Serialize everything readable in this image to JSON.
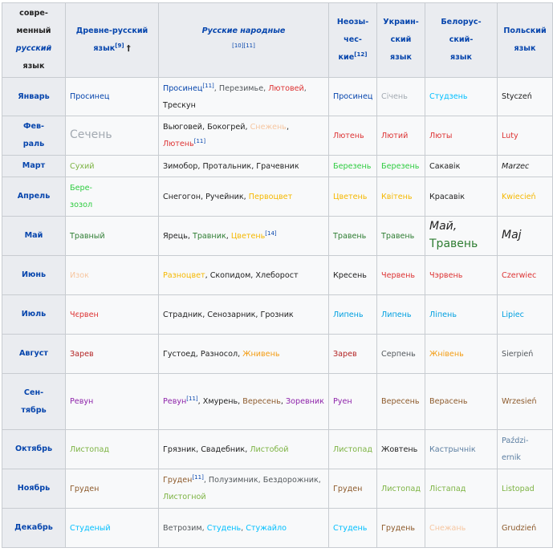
{
  "headers": [
    {
      "lines": [
        "совре-",
        "менный",
        "русский",
        "язык"
      ],
      "italic_line": 2
    },
    {
      "lines": [
        "Древне-русский",
        "язык"
      ],
      "sup": "[9]",
      "dagger": "†"
    },
    {
      "lines": [
        "Русские народные"
      ],
      "sup_line": "[10][11]",
      "italic": true
    },
    {
      "lines": [
        "Неозы-",
        "чес-",
        "кие"
      ],
      "sup": "[12]"
    },
    {
      "lines": [
        "Украин-",
        "ский",
        "язык"
      ]
    },
    {
      "lines": [
        "Белорус-",
        "ский-",
        "язык"
      ]
    },
    {
      "lines": [
        "Польский",
        "язык"
      ]
    }
  ],
  "rows": [
    {
      "month": [
        "Январь"
      ],
      "old": [
        {
          "t": "Просинец",
          "c": "#0645ad"
        }
      ],
      "folk": [
        {
          "t": "Просинец",
          "c": "#0645ad",
          "sup": "[11]"
        },
        {
          "t": ", Перезимье, ",
          "c": "#54595d"
        },
        {
          "t": "Лютовей",
          "c": "#d33"
        },
        {
          "t": ",",
          "c": "#54595d"
        },
        {
          "br": true
        },
        {
          "t": "Трескун",
          "c": "#222"
        }
      ],
      "neo": [
        {
          "t": "Просинец",
          "c": "#0645ad"
        }
      ],
      "ukr": [
        {
          "t": "Січень",
          "c": "#a2a9b1"
        }
      ],
      "bel": [
        {
          "t": "Студзень",
          "c": "#00bfff"
        }
      ],
      "pol": [
        {
          "t": "Styczeń",
          "c": "#222"
        }
      ]
    },
    {
      "month": [
        "Фев-",
        "раль"
      ],
      "old": [
        {
          "t": "Сечень",
          "c": "#a2a9b1",
          "big": true
        }
      ],
      "folk": [
        {
          "t": "Вьюговей, Бокогрей, ",
          "c": "#222"
        },
        {
          "t": "Снежень",
          "c": "#f6c6a0"
        },
        {
          "t": ",",
          "c": "#222"
        },
        {
          "br": true
        },
        {
          "t": "Лютень",
          "c": "#d33",
          "sup": "[11]"
        }
      ],
      "neo": [
        {
          "t": "Лютень",
          "c": "#d33"
        }
      ],
      "ukr": [
        {
          "t": "Лютий",
          "c": "#d33"
        }
      ],
      "bel": [
        {
          "t": "Люты",
          "c": "#d33"
        }
      ],
      "pol": [
        {
          "t": "Luty",
          "c": "#d33"
        }
      ]
    },
    {
      "month": [
        "Март"
      ],
      "old": [
        {
          "t": "Сухий",
          "c": "#7cb342"
        }
      ],
      "folk": [
        {
          "t": "Зимобор, Протальник, Грачевник",
          "c": "#222"
        }
      ],
      "neo": [
        {
          "t": "Березень",
          "c": "#2ecc40"
        }
      ],
      "ukr": [
        {
          "t": "Березень",
          "c": "#2ecc40"
        }
      ],
      "bel": [
        {
          "t": "Сакавік",
          "c": "#222"
        }
      ],
      "pol": [
        {
          "t": "Marzec",
          "c": "#222",
          "italic": true
        }
      ]
    },
    {
      "month": [
        "Апрель"
      ],
      "old": [
        {
          "t": "Бере-",
          "c": "#2ecc40"
        },
        {
          "br": true
        },
        {
          "t": "зозол",
          "c": "#2ecc40"
        }
      ],
      "folk": [
        {
          "t": "Снегогон, Ручейник, ",
          "c": "#222"
        },
        {
          "t": "Первоцвет",
          "c": "#f5b800"
        }
      ],
      "neo": [
        {
          "t": "Цветень",
          "c": "#f5b800"
        }
      ],
      "ukr": [
        {
          "t": "Квітень",
          "c": "#f5b800"
        }
      ],
      "bel": [
        {
          "t": "Красавік",
          "c": "#222"
        }
      ],
      "pol": [
        {
          "t": "Kwiecień",
          "c": "#f5b800"
        }
      ]
    },
    {
      "month": [
        "Май"
      ],
      "old": [
        {
          "t": "Травный",
          "c": "#2e7d32"
        }
      ],
      "folk": [
        {
          "t": "Ярець, ",
          "c": "#222"
        },
        {
          "t": "Травник",
          "c": "#2e7d32"
        },
        {
          "t": ", ",
          "c": "#222"
        },
        {
          "t": "Цветень",
          "c": "#f5b800",
          "sup": "[14]"
        }
      ],
      "neo": [
        {
          "t": "Травень",
          "c": "#2e7d32"
        }
      ],
      "ukr": [
        {
          "t": "Травень",
          "c": "#2e7d32"
        }
      ],
      "bel": [
        {
          "t": "Май,",
          "c": "#222",
          "big": true,
          "italic": true
        },
        {
          "br": true
        },
        {
          "t": "Травень",
          "c": "#2e7d32",
          "big": true
        }
      ],
      "pol": [
        {
          "t": "Maj",
          "c": "#222",
          "big": true,
          "italic": true
        }
      ]
    },
    {
      "month": [
        "Июнь"
      ],
      "old": [
        {
          "t": "Изок",
          "c": "#f6c6a0"
        }
      ],
      "folk": [
        {
          "t": "Разноцвет",
          "c": "#f5b800"
        },
        {
          "t": ", Скопидом, Хлеборост",
          "c": "#222"
        }
      ],
      "neo": [
        {
          "t": "Кресень",
          "c": "#222"
        }
      ],
      "ukr": [
        {
          "t": "Червень",
          "c": "#d33"
        }
      ],
      "bel": [
        {
          "t": "Чэрвень",
          "c": "#d33"
        }
      ],
      "pol": [
        {
          "t": "Czerwiec",
          "c": "#d33"
        }
      ]
    },
    {
      "month": [
        "Июль"
      ],
      "old": [
        {
          "t": "Чєрвен",
          "c": "#d33"
        }
      ],
      "folk": [
        {
          "t": "Страдник, Сенозарник, Грозник",
          "c": "#222"
        }
      ],
      "neo": [
        {
          "t": "Липень",
          "c": "#00a0e0"
        }
      ],
      "ukr": [
        {
          "t": "Липень",
          "c": "#00a0e0"
        }
      ],
      "bel": [
        {
          "t": "Ліпень",
          "c": "#00a0e0"
        }
      ],
      "pol": [
        {
          "t": "Lipiec",
          "c": "#00a0e0"
        }
      ]
    },
    {
      "month": [
        "Август"
      ],
      "old": [
        {
          "t": "Зарев",
          "c": "#b32424"
        }
      ],
      "folk": [
        {
          "t": "Густоед, Разносол, ",
          "c": "#222"
        },
        {
          "t": "Жнивень",
          "c": "#f39c12"
        }
      ],
      "neo": [
        {
          "t": "Зарев",
          "c": "#b32424"
        }
      ],
      "ukr": [
        {
          "t": "Серпень",
          "c": "#54595d"
        }
      ],
      "bel": [
        {
          "t": "Жнівень",
          "c": "#f39c12"
        }
      ],
      "pol": [
        {
          "t": "Sierpień",
          "c": "#54595d"
        }
      ]
    },
    {
      "month": [
        "Сен-",
        "тябрь"
      ],
      "old": [
        {
          "t": "Ревун",
          "c": "#8e24aa"
        }
      ],
      "folk": [
        {
          "t": "Ревун",
          "c": "#8e24aa",
          "sup": "[11]"
        },
        {
          "t": ", Хмурень, ",
          "c": "#222"
        },
        {
          "t": "Вересень",
          "c": "#8d5a2b"
        },
        {
          "t": ", ",
          "c": "#222"
        },
        {
          "t": "Зоревник",
          "c": "#8e24aa"
        }
      ],
      "neo": [
        {
          "t": "Руен",
          "c": "#8e24aa"
        }
      ],
      "ukr": [
        {
          "t": "Вересень",
          "c": "#8d5a2b"
        }
      ],
      "bel": [
        {
          "t": "Верасень",
          "c": "#8d5a2b"
        }
      ],
      "pol": [
        {
          "t": "Wrzesień",
          "c": "#8d5a2b"
        }
      ]
    },
    {
      "month": [
        "Октябрь"
      ],
      "old": [
        {
          "t": "Листопад",
          "c": "#7cb342"
        }
      ],
      "folk": [
        {
          "t": "Грязник, Свадебник, ",
          "c": "#222"
        },
        {
          "t": "Листобой",
          "c": "#7cb342"
        }
      ],
      "neo": [
        {
          "t": "Листопад",
          "c": "#7cb342"
        }
      ],
      "ukr": [
        {
          "t": "Жовтень",
          "c": "#222"
        }
      ],
      "bel": [
        {
          "t": "Кастрычнік",
          "c": "#5b7ea1"
        }
      ],
      "pol": [
        {
          "t": "Paździ-",
          "c": "#5b7ea1"
        },
        {
          "br": true
        },
        {
          "t": "ernik",
          "c": "#5b7ea1"
        }
      ]
    },
    {
      "month": [
        "Ноябрь"
      ],
      "old": [
        {
          "t": "Груден",
          "c": "#8d5a2b"
        }
      ],
      "folk": [
        {
          "t": "Груден",
          "c": "#8d5a2b",
          "sup": "[11]"
        },
        {
          "t": ", Полузимник, Бездорожник,",
          "c": "#54595d"
        },
        {
          "br": true
        },
        {
          "t": "Листогной",
          "c": "#7cb342"
        }
      ],
      "neo": [
        {
          "t": "Груден",
          "c": "#8d5a2b"
        }
      ],
      "ukr": [
        {
          "t": "Листопад",
          "c": "#7cb342"
        }
      ],
      "bel": [
        {
          "t": "Лістапад",
          "c": "#7cb342"
        }
      ],
      "pol": [
        {
          "t": "Listopad",
          "c": "#7cb342"
        }
      ]
    },
    {
      "month": [
        "Декабрь"
      ],
      "old": [
        {
          "t": "Студеный",
          "c": "#00bfff"
        }
      ],
      "folk": [
        {
          "t": "Ветрозим, ",
          "c": "#54595d"
        },
        {
          "t": "Студень",
          "c": "#00bfff"
        },
        {
          "t": ", ",
          "c": "#54595d"
        },
        {
          "t": "Стужайло",
          "c": "#00bfff"
        }
      ],
      "neo": [
        {
          "t": "Студень",
          "c": "#00bfff"
        }
      ],
      "ukr": [
        {
          "t": "Грудень",
          "c": "#8d5a2b"
        }
      ],
      "bel": [
        {
          "t": "Снежань",
          "c": "#f6c6a0"
        }
      ],
      "pol": [
        {
          "t": "Grudzień",
          "c": "#8d5a2b"
        }
      ]
    }
  ]
}
